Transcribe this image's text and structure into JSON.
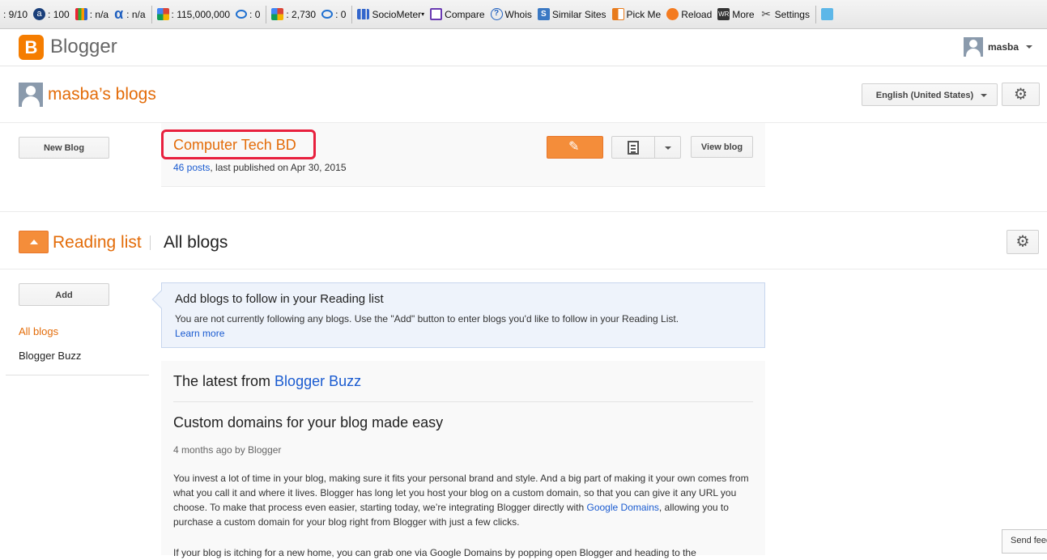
{
  "toolbar": {
    "items": [
      {
        "icon": "pr-icon",
        "text": ": 9/10"
      },
      {
        "icon": "alexa-icon",
        "text": ": 100"
      },
      {
        "icon": "bars-icon",
        "text": ": n/a"
      },
      {
        "icon": "alpha-icon",
        "text": ": n/a"
      },
      {
        "icon": "google-icon",
        "text": ": 115,000,000"
      },
      {
        "icon": "bing-icon",
        "text": ": 0"
      },
      {
        "icon": "google-icon",
        "text": ": 2,730"
      },
      {
        "icon": "bing-icon",
        "text": ": 0"
      }
    ],
    "tools": {
      "sociometer": "SocioMeter",
      "compare": "Compare",
      "whois": "Whois",
      "similar_sites": "Similar Sites",
      "pick_me": "Pick Me",
      "reload": "Reload",
      "more": "More",
      "settings": "Settings"
    }
  },
  "header": {
    "brand": "Blogger",
    "username": "masba",
    "colors": {
      "accent": "#f57d00",
      "link": "#1a5bd0",
      "title": "#e36c09"
    }
  },
  "blogs_section": {
    "title": "masba’s blogs",
    "language": "English (United States)",
    "new_blog_label": "New Blog",
    "blog": {
      "title": "Computer Tech BD",
      "posts_link": "46 posts",
      "meta": ", last published on Apr 30, 2015",
      "view_label": "View blog"
    }
  },
  "reading_list": {
    "title": "Reading list",
    "filter": "All blogs",
    "add_label": "Add",
    "sidebar": {
      "all_blogs": "All blogs",
      "blogger_buzz": "Blogger Buzz"
    },
    "info": {
      "title": "Add blogs to follow in your Reading list",
      "body": "You are not currently following any blogs. Use the \"Add\" button to enter blogs you'd like to follow in your Reading List.",
      "learn_more": "Learn more"
    },
    "buzz": {
      "heading_prefix": "The latest from ",
      "heading_link": "Blogger Buzz",
      "post_title": "Custom domains for your blog made easy",
      "post_meta": "4 months ago by Blogger",
      "body_part1": "You invest a lot of time in your blog, making sure it fits your personal brand and style. And a big part of making it your own comes from what you call it and where it lives. Blogger has long let you host your blog on a custom domain, so that you can give it any URL you choose. To make that process even easier, starting today, we’re integrating Blogger directly with ",
      "body_link": "Google Domains",
      "body_part2": ", allowing you to purchase a custom domain for your blog right from Blogger with just a few clicks.",
      "body_next": "If your blog is itching for a new home, you can grab one via Google Domains by popping open Blogger and heading to the"
    }
  },
  "feedback_label": "Send feedback"
}
